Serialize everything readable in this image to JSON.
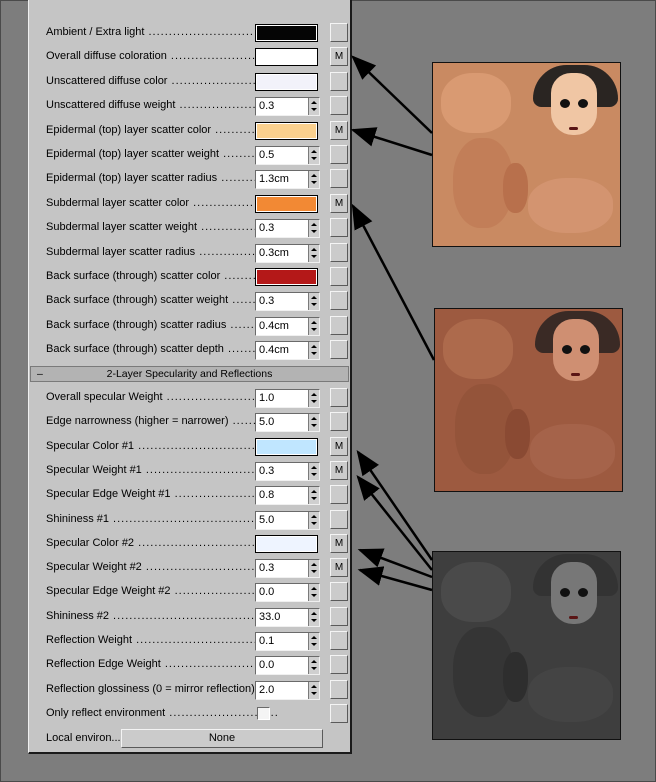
{
  "rows_top": [
    {
      "label": "Ambient / Extra light",
      "type": "color",
      "color": "#050505",
      "m": false
    },
    {
      "label": "Overall diffuse coloration",
      "type": "color",
      "color": "#ffffff",
      "m": true
    },
    {
      "label": "Unscattered diffuse color",
      "type": "color",
      "color": "#f2f2fa",
      "m": false
    },
    {
      "label": "Unscattered diffuse weight",
      "type": "num",
      "value": "0.3",
      "m": false
    },
    {
      "label": "Epidermal (top) layer scatter color",
      "type": "color",
      "color": "#fad08e",
      "m": true
    },
    {
      "label": "Epidermal (top) layer scatter weight",
      "type": "num",
      "value": "0.5",
      "m": false
    },
    {
      "label": "Epidermal (top) layer scatter radius",
      "type": "num",
      "value": "1.3cm",
      "m": false
    },
    {
      "label": "Subdermal layer scatter color",
      "type": "color",
      "color": "#f28934",
      "m": true
    },
    {
      "label": "Subdermal layer scatter weight",
      "type": "num",
      "value": "0.3",
      "m": false
    },
    {
      "label": "Subdermal layer scatter radius",
      "type": "num",
      "value": "0.3cm",
      "m": false
    },
    {
      "label": "Back surface (through) scatter color",
      "type": "color",
      "color": "#b41818",
      "m": false
    },
    {
      "label": "Back surface (through) scatter weight",
      "type": "num",
      "value": "0.3",
      "m": false
    },
    {
      "label": "Back surface (through) scatter radius",
      "type": "num",
      "value": "0.4cm",
      "m": false
    },
    {
      "label": "Back surface (through) scatter depth",
      "type": "num",
      "value": "0.4cm",
      "m": false
    }
  ],
  "section": {
    "toggle": "–",
    "title": "2-Layer Specularity and Reflections"
  },
  "rows_bottom": [
    {
      "label": "Overall specular Weight",
      "type": "num",
      "value": "1.0",
      "m": false
    },
    {
      "label": "Edge narrowness (higher = narrower)",
      "type": "num",
      "value": "5.0",
      "m": false
    },
    {
      "label": "Specular Color #1",
      "type": "color",
      "color": "#c0e6ff",
      "m": true
    },
    {
      "label": "Specular Weight #1",
      "type": "num",
      "value": "0.3",
      "m": true
    },
    {
      "label": "Specular Edge Weight #1",
      "type": "num",
      "value": "0.8",
      "m": false
    },
    {
      "label": "Shininess #1",
      "type": "num",
      "value": "5.0",
      "m": false
    },
    {
      "label": "Specular Color #2",
      "type": "color",
      "color": "#eef4ff",
      "m": true
    },
    {
      "label": "Specular Weight #2",
      "type": "num",
      "value": "0.3",
      "m": true
    },
    {
      "label": "Specular Edge Weight #2",
      "type": "num",
      "value": "0.0",
      "m": false
    },
    {
      "label": "Shininess #2",
      "type": "num",
      "value": "33.0",
      "m": false
    },
    {
      "label": "Reflection Weight",
      "type": "num",
      "value": "0.1",
      "m": false
    },
    {
      "label": "Reflection Edge Weight",
      "type": "num",
      "value": "0.0",
      "m": false
    },
    {
      "label": "Reflection glossiness (0 = mirror reflection)",
      "type": "num",
      "value": "2.0",
      "m": false
    },
    {
      "label": "Only reflect environment",
      "type": "check",
      "checked": false,
      "m": false
    }
  ],
  "local_env": {
    "label": "Local environ...",
    "button": "None"
  },
  "m_label": "M",
  "textures": [
    {
      "name": "diffuse-texture",
      "tint": "#c98a62",
      "face_skin": "#f0c6a4",
      "hair": "#2a2522"
    },
    {
      "name": "subdermal-texture",
      "tint": "#9d5a40",
      "face_skin": "#cf8f72",
      "hair": "#3a2a25"
    },
    {
      "name": "specular-texture",
      "tint": "#3e3e3e",
      "face_skin": "#777777",
      "hair": "#333333"
    }
  ]
}
